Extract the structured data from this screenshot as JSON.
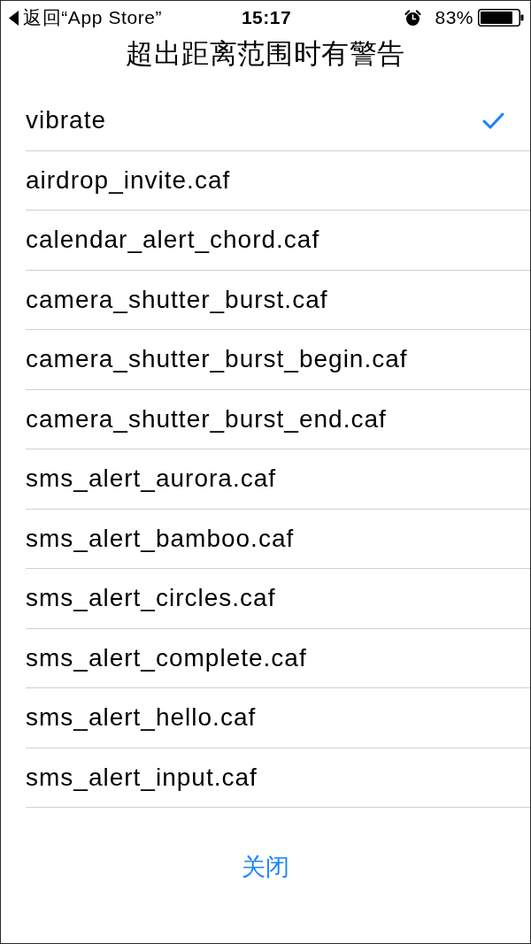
{
  "status_bar": {
    "back_label": "返回“App Store”",
    "time": "15:17",
    "battery_percent": "83%"
  },
  "title": "超出距离范围时有警告",
  "sounds": [
    {
      "label": "vibrate",
      "selected": true
    },
    {
      "label": "airdrop_invite.caf",
      "selected": false
    },
    {
      "label": "calendar_alert_chord.caf",
      "selected": false
    },
    {
      "label": "camera_shutter_burst.caf",
      "selected": false
    },
    {
      "label": "camera_shutter_burst_begin.caf",
      "selected": false
    },
    {
      "label": "camera_shutter_burst_end.caf",
      "selected": false
    },
    {
      "label": "sms_alert_aurora.caf",
      "selected": false
    },
    {
      "label": "sms_alert_bamboo.caf",
      "selected": false
    },
    {
      "label": "sms_alert_circles.caf",
      "selected": false
    },
    {
      "label": "sms_alert_complete.caf",
      "selected": false
    },
    {
      "label": "sms_alert_hello.caf",
      "selected": false
    },
    {
      "label": "sms_alert_input.caf",
      "selected": false
    }
  ],
  "close_button": "关闭"
}
